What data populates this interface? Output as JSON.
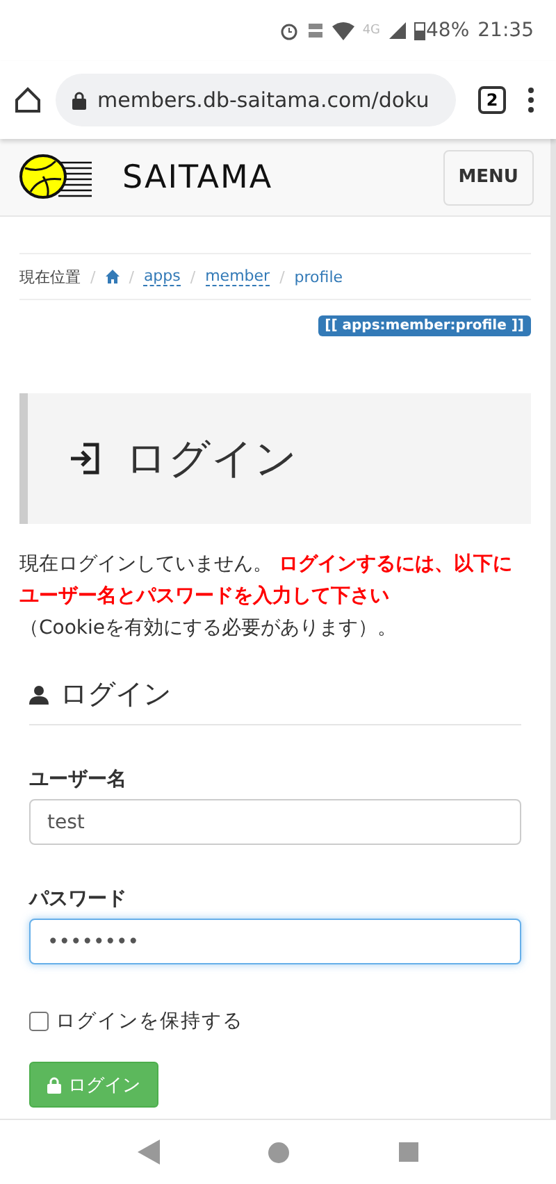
{
  "status_bar": {
    "network": "4G",
    "battery": "48%",
    "time": "21:35"
  },
  "browser": {
    "url": "members.db-saitama.com/doku",
    "tab_count": "2"
  },
  "site_header": {
    "logo_text": "SAITAMA",
    "menu_button": "MENU"
  },
  "breadcrumb": {
    "label": "現在位置",
    "separator": "/",
    "items": [
      "apps",
      "member",
      "profile"
    ]
  },
  "page_id_badge": "[[ apps:member:profile ]]",
  "page_title": "ログイン",
  "notice": {
    "text": "現在ログインしていません。",
    "warning": "ログインするには、以下にユーザー名とパスワードを入力して下さい",
    "note": "（Cookieを有効にする必要があります）。"
  },
  "form": {
    "heading": "ログイン",
    "fields": [
      {
        "label": "ユーザー名",
        "value": "test",
        "focused": false
      },
      {
        "label": "パスワード",
        "value": "••••••••",
        "focused": true
      }
    ],
    "remember": {
      "label": "ログインを保持する",
      "checked": false
    },
    "submit": "ログイン"
  }
}
